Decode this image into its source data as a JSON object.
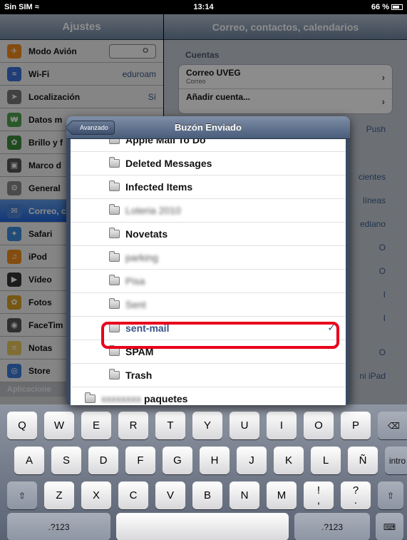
{
  "status_bar": {
    "carrier": "Sin SIM",
    "wifi": "≈",
    "time": "13:14",
    "battery": "66 %"
  },
  "left_pane": {
    "title": "Ajustes",
    "items": [
      {
        "label": "Modo Avión",
        "value": "O",
        "kind": "switch",
        "color": "#f08a1c",
        "icon": "airplane-icon",
        "glyph": "✈"
      },
      {
        "label": "Wi-Fi",
        "value": "eduroam",
        "kind": "value",
        "color": "#3a6fd8",
        "icon": "wifi-icon",
        "glyph": "≈"
      },
      {
        "label": "Localización",
        "value": "Sí",
        "kind": "value",
        "color": "#777",
        "icon": "location-icon",
        "glyph": "➤"
      },
      {
        "label": "Datos m",
        "value": "",
        "kind": "value",
        "color": "#4aa04a",
        "icon": "cellular-icon",
        "glyph": "₩"
      },
      {
        "label": "Brillo y f",
        "value": "",
        "kind": "value",
        "color": "#3a8a3a",
        "icon": "brightness-icon",
        "glyph": "✿"
      },
      {
        "label": "Marco d",
        "value": "",
        "kind": "value",
        "color": "#555",
        "icon": "picture-frame-icon",
        "glyph": "▣"
      },
      {
        "label": "General",
        "value": "",
        "kind": "value",
        "color": "#888",
        "icon": "gear-icon",
        "glyph": "⚙"
      },
      {
        "label": "Correo, c",
        "value": "",
        "kind": "selected",
        "color": "#4c82d6",
        "icon": "mail-icon",
        "glyph": "✉"
      },
      {
        "label": "Safari",
        "value": "",
        "kind": "value",
        "color": "#3b8ad8",
        "icon": "compass-icon",
        "glyph": "✦"
      },
      {
        "label": "iPod",
        "value": "",
        "kind": "value",
        "color": "#f08a1c",
        "icon": "music-icon",
        "glyph": "♫"
      },
      {
        "label": "Vídeo",
        "value": "",
        "kind": "value",
        "color": "#333",
        "icon": "video-icon",
        "glyph": "▶"
      },
      {
        "label": "Fotos",
        "value": "",
        "kind": "value",
        "color": "#d8a020",
        "icon": "flower-icon",
        "glyph": "✿"
      },
      {
        "label": "FaceTim",
        "value": "",
        "kind": "value",
        "color": "#555",
        "icon": "camera-icon",
        "glyph": "◉"
      },
      {
        "label": "Notas",
        "value": "",
        "kind": "value",
        "color": "#e8c65a",
        "icon": "notes-icon",
        "glyph": "≡"
      },
      {
        "label": "Store",
        "value": "",
        "kind": "value",
        "color": "#3b7ad8",
        "icon": "store-icon",
        "glyph": "◎"
      }
    ],
    "section": "Aplicacione"
  },
  "right_pane": {
    "title": "Correo, contactos, calendarios",
    "section": "Cuentas",
    "accounts": [
      {
        "label": "Correo UVEG",
        "sub": "Correo"
      },
      {
        "label": "Añadir cuenta...",
        "sub": ""
      }
    ],
    "values": [
      "Push",
      "cientes",
      "líneas",
      "ediano",
      "O",
      "O",
      "I",
      "I",
      "O",
      "ni iPad"
    ]
  },
  "popover": {
    "back_label": "Avanzado",
    "title": "Buzón Enviado",
    "folders": [
      {
        "label": "Apple Mail To Do",
        "blurred": false,
        "selected": false
      },
      {
        "label": "Deleted Messages",
        "blurred": false,
        "selected": false
      },
      {
        "label": "Infected Items",
        "blurred": false,
        "selected": false
      },
      {
        "label": "Loteria 2010",
        "blurred": true,
        "selected": false
      },
      {
        "label": "Novetats",
        "blurred": false,
        "selected": false
      },
      {
        "label": "parking",
        "blurred": true,
        "selected": false
      },
      {
        "label": "Pisa",
        "blurred": true,
        "selected": false
      },
      {
        "label": "Sent",
        "blurred": true,
        "selected": false
      },
      {
        "label": "sent-mail",
        "blurred": false,
        "selected": true
      },
      {
        "label": "SPAM",
        "blurred": false,
        "selected": false
      },
      {
        "label": "Trash",
        "blurred": false,
        "selected": false
      }
    ],
    "parent_folder": {
      "label_blurred": "xxxxxxxx",
      "label": "paquetes"
    },
    "checkmark": "✓"
  },
  "keyboard": {
    "row1": [
      "Q",
      "W",
      "E",
      "R",
      "T",
      "Y",
      "U",
      "I",
      "O",
      "P"
    ],
    "backspace": "⌫",
    "row2": [
      "A",
      "S",
      "D",
      "F",
      "G",
      "H",
      "J",
      "K",
      "L",
      "Ñ"
    ],
    "return": "intro",
    "shift": "⇧",
    "row3": [
      "Z",
      "X",
      "C",
      "V",
      "B",
      "N",
      "M",
      "!\n,",
      "?\n."
    ],
    "numbers": ".?123",
    "hide": "⌨"
  },
  "colors": {
    "highlight": "#e8001c",
    "selected_text": "#385487"
  }
}
